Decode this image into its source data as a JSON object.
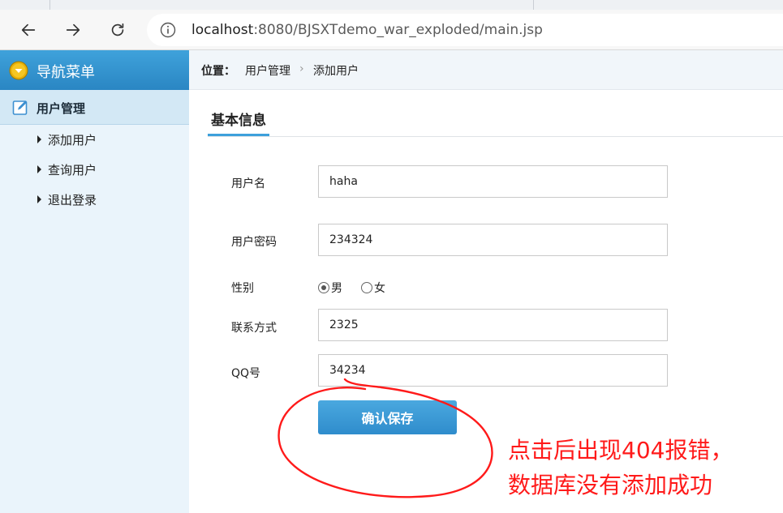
{
  "browser": {
    "url_host": "localhost",
    "url_rest": ":8080/BJSXTdemo_war_exploded/main.jsp"
  },
  "sidebar": {
    "title": "导航菜单",
    "group_label": "用户管理",
    "items": [
      {
        "label": "添加用户"
      },
      {
        "label": "查询用户"
      },
      {
        "label": "退出登录"
      }
    ]
  },
  "breadcrumb": {
    "lead": "位置：",
    "items": [
      "用户管理",
      "添加用户"
    ],
    "separator": "›"
  },
  "form": {
    "section_title": "基本信息",
    "username": {
      "label": "用户名",
      "value": "haha"
    },
    "password": {
      "label": "用户密码",
      "value": "234324"
    },
    "gender": {
      "label": "性别",
      "options": [
        {
          "label": "男",
          "checked": true
        },
        {
          "label": "女",
          "checked": false
        }
      ]
    },
    "contact": {
      "label": "联系方式",
      "value": "2325"
    },
    "qq": {
      "label": "QQ号",
      "value": "34234"
    },
    "submit_label": "确认保存"
  },
  "annotation": {
    "line1": "点击后出现404报错，",
    "line2": "数据库没有添加成功",
    "color": "#ff1a1a"
  },
  "colors": {
    "accent": "#2f8ccc",
    "sidebar_bg": "#eaf4fb"
  }
}
